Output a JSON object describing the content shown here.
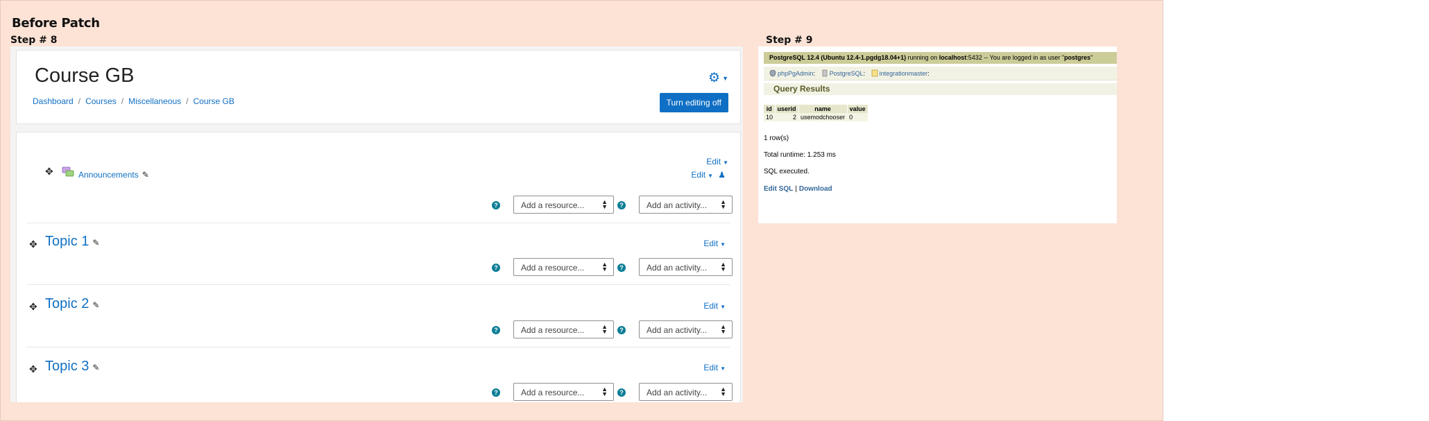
{
  "page": {
    "title": "Before Patch",
    "step8": "Step # 8",
    "step9": "Step # 9"
  },
  "moodle": {
    "course_title": "Course GB",
    "breadcrumb": [
      "Dashboard",
      "Courses",
      "Miscellaneous",
      "Course GB"
    ],
    "turn_editing_off": "Turn editing off",
    "edit_label": "Edit",
    "announcements": "Announcements",
    "add_resource": "Add a resource...",
    "add_activity": "Add an activity...",
    "topics": [
      "Topic 1",
      "Topic 2",
      "Topic 3"
    ],
    "help_glyph": "?",
    "colors": {
      "link": "#0f6fc5",
      "button": "#0f6fc5",
      "help": "#0d7e96"
    }
  },
  "pg": {
    "server_bar": {
      "product": "PostgreSQL 12.4 (Ubuntu 12.4-1.pgdg18.04+1)",
      "running_on": "running on",
      "host": "localhost",
      "port_text": ":5432 -- You are logged in as user \"",
      "user": "postgres",
      "end_quote": "\""
    },
    "trail": [
      "phpPgAdmin",
      "PostgreSQL",
      "integrationmaster"
    ],
    "trail_sep": ":",
    "query_results": "Query Results",
    "table": {
      "headers": [
        "id",
        "userid",
        "name",
        "value"
      ],
      "row": [
        "10",
        "2",
        "usemodchooser",
        "0"
      ]
    },
    "rows_text": "1 row(s)",
    "runtime_text": "Total runtime: 1.253 ms",
    "executed_text": "SQL executed.",
    "edit_sql": "Edit SQL",
    "bar": "|",
    "download": "Download",
    "colors": {
      "top_bar": "#cccc99",
      "link": "#336699"
    }
  }
}
